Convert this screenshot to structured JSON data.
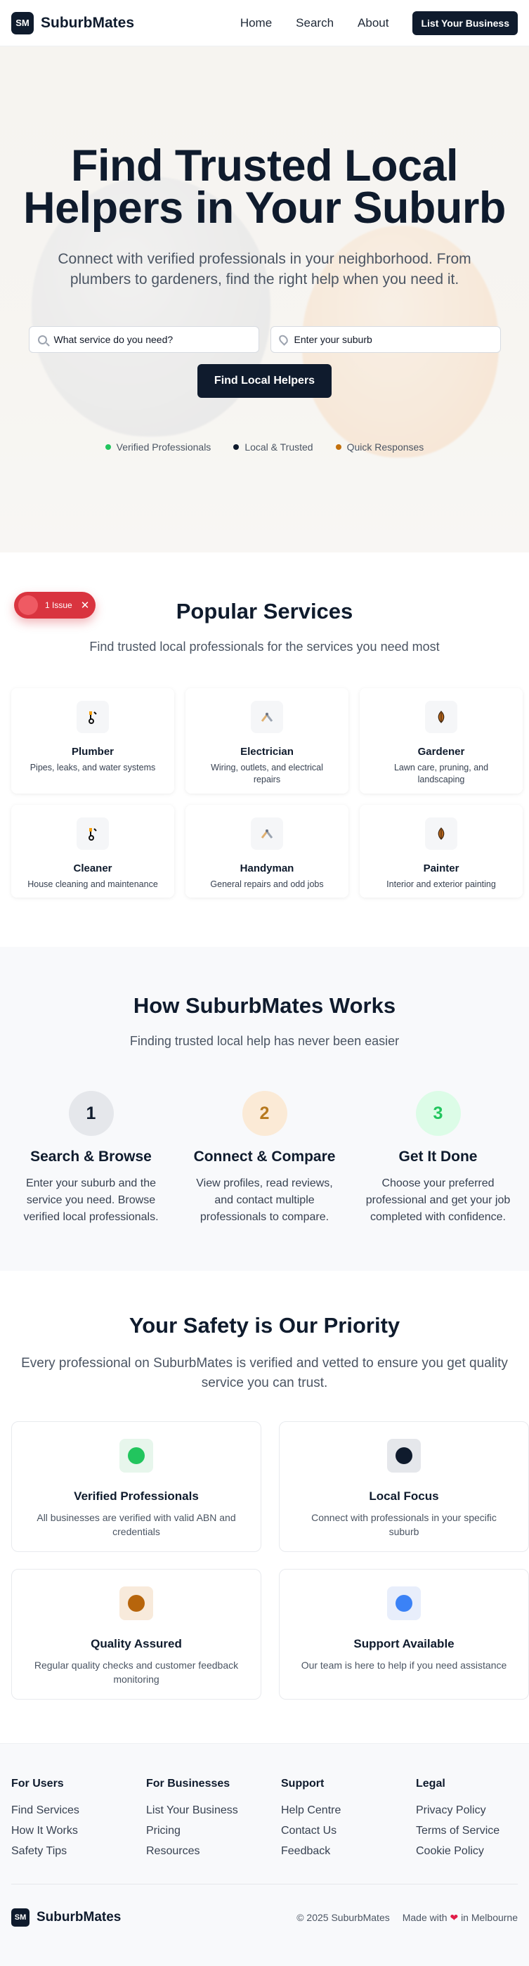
{
  "header": {
    "logo_text": "SM",
    "brand": "SuburbMates",
    "nav": [
      "Home",
      "Search",
      "About"
    ],
    "cta": "List Your Business"
  },
  "hero": {
    "title_line1": "Find Trusted Local",
    "title_line2": "Helpers in Your Suburb",
    "subtitle": "Connect with verified professionals in your neighborhood. From plumbers to gardeners, find the right help when you need it.",
    "service_placeholder": "What service do you need?",
    "suburb_placeholder": "Enter your suburb",
    "button": "Find Local Helpers",
    "badges": [
      {
        "label": "Verified Professionals",
        "color": "#22c55e"
      },
      {
        "label": "Local & Trusted",
        "color": "#0f1b2d"
      },
      {
        "label": "Quick Responses",
        "color": "#c2700c"
      }
    ]
  },
  "issue_pill": {
    "label": "1 Issue",
    "close": "✕"
  },
  "services": {
    "title": "Popular Services",
    "subtitle": "Find trusted local professionals for the services you need most",
    "items": [
      {
        "name": "Plumber",
        "desc": "Pipes, leaks, and water systems",
        "icon": "wrench-icon"
      },
      {
        "name": "Electrician",
        "desc": "Wiring, outlets, and electrical repairs",
        "icon": "tools-icon"
      },
      {
        "name": "Gardener",
        "desc": "Lawn care, pruning, and landscaping",
        "icon": "leaf-icon"
      },
      {
        "name": "Cleaner",
        "desc": "House cleaning and maintenance",
        "icon": "wrench-icon"
      },
      {
        "name": "Handyman",
        "desc": "General repairs and odd jobs",
        "icon": "tools-icon"
      },
      {
        "name": "Painter",
        "desc": "Interior and exterior painting",
        "icon": "leaf-icon"
      }
    ]
  },
  "how": {
    "title": "How SuburbMates Works",
    "subtitle": "Finding trusted local help has never been easier",
    "steps": [
      {
        "num": "1",
        "title": "Search & Browse",
        "desc": "Enter your suburb and the service you need. Browse verified local professionals.",
        "bg": "#e5e7eb",
        "fg": "#0f1b2d"
      },
      {
        "num": "2",
        "title": "Connect & Compare",
        "desc": "View profiles, read reviews, and contact multiple professionals to compare.",
        "bg": "#fbead6",
        "fg": "#b7791f"
      },
      {
        "num": "3",
        "title": "Get It Done",
        "desc": "Choose your preferred professional and get your job completed with confidence.",
        "bg": "#dcfce7",
        "fg": "#22c55e"
      }
    ]
  },
  "safety": {
    "title": "Your Safety is Our Priority",
    "subtitle": "Every professional on SuburbMates is verified and vetted to ensure you get quality service you can trust.",
    "items": [
      {
        "title": "Verified Professionals",
        "desc": "All businesses are verified with valid ABN and credentials",
        "bg": "#e7f6ec",
        "fg": "#22c55e"
      },
      {
        "title": "Local Focus",
        "desc": "Connect with professionals in your specific suburb",
        "bg": "#e5e7eb",
        "fg": "#0f1b2d"
      },
      {
        "title": "Quality Assured",
        "desc": "Regular quality checks and customer feedback monitoring",
        "bg": "#f8eadb",
        "fg": "#b7650c"
      },
      {
        "title": "Support Available",
        "desc": "Our team is here to help if you need assistance",
        "bg": "#e8eefb",
        "fg": "#3b82f6"
      }
    ]
  },
  "footer": {
    "columns": [
      {
        "title": "For Users",
        "links": [
          "Find Services",
          "How It Works",
          "Safety Tips"
        ]
      },
      {
        "title": "For Businesses",
        "links": [
          "List Your Business",
          "Pricing",
          "Resources"
        ]
      },
      {
        "title": "Support",
        "links": [
          "Help Centre",
          "Contact Us",
          "Feedback"
        ]
      },
      {
        "title": "Legal",
        "links": [
          "Privacy Policy",
          "Terms of Service",
          "Cookie Policy"
        ]
      }
    ],
    "logo_text": "SM",
    "brand": "SuburbMates",
    "copyright": "© 2025 SuburbMates",
    "made_prefix": "Made with",
    "heart": "❤",
    "made_suffix": "in Melbourne"
  }
}
